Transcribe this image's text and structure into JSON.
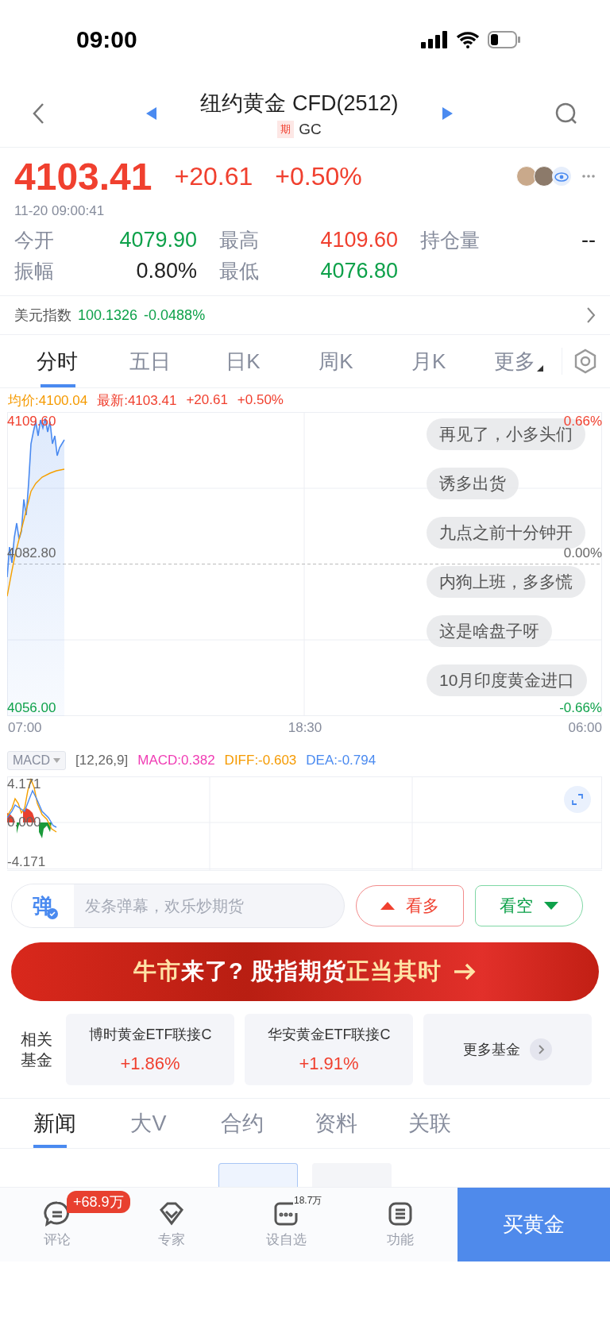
{
  "status_bar": {
    "time": "09:00"
  },
  "header": {
    "title": "纽约黄金 CFD(2512)",
    "tag": "期",
    "code": "GC"
  },
  "quote": {
    "price": "4103.41",
    "change": "+20.61",
    "change_pct": "+0.50%",
    "timestamp": "11-20 09:00:41"
  },
  "stats": [
    {
      "label": "今开",
      "value": "4079.90",
      "color": "#0ea14a"
    },
    {
      "label": "最高",
      "value": "4109.60",
      "color": "#f0402f"
    },
    {
      "label": "持仓量",
      "value": "--",
      "color": "#222222"
    },
    {
      "label": "振幅",
      "value": "0.80%",
      "color": "#222222"
    },
    {
      "label": "最低",
      "value": "4076.80",
      "color": "#0ea14a"
    }
  ],
  "index_bar": {
    "label": "美元指数",
    "value": "100.1326",
    "change": "-0.0488%"
  },
  "chart_tabs": [
    {
      "label": "分时",
      "selected": true,
      "kind": "tab"
    },
    {
      "label": "五日",
      "selected": false,
      "kind": "tab"
    },
    {
      "label": "日K",
      "selected": false,
      "kind": "tab"
    },
    {
      "label": "周K",
      "selected": false,
      "kind": "tab"
    },
    {
      "label": "月K",
      "selected": false,
      "kind": "tab"
    },
    {
      "label": "更多",
      "selected": false,
      "kind": "menu"
    }
  ],
  "intraday": {
    "avg": "均价:4100.04",
    "latest": "最新:4103.41",
    "change": "+20.61",
    "change_pct": "+0.50%",
    "y_high": "4109.60",
    "y_mid": "4082.80",
    "y_low": "4056.00",
    "pct_high": "0.66%",
    "pct_mid": "0.00%",
    "pct_low": "-0.66%",
    "x_labels": [
      "07:00",
      "18:30",
      "06:00"
    ]
  },
  "danmaku": [
    "再见了，小多头们",
    "诱多出货",
    "九点之前十分钟开",
    "内狗上班，多多慌",
    "这是啥盘子呀",
    "10月印度黄金进口"
  ],
  "macd": {
    "selector": "MACD",
    "params": "[12,26,9]",
    "macd": "MACD:0.382",
    "diff": "DIFF:-0.603",
    "dea": "DEA:-0.794",
    "y_high": "4.171",
    "y_mid": "0.000",
    "y_low": "-4.171"
  },
  "comment_bar": {
    "badge": "弹",
    "placeholder": "发条弹幕，欢乐炒期货",
    "bull": "看多",
    "bear": "看空"
  },
  "banner": {
    "text": "**牛市**来了? 股指期货**正当其时**"
  },
  "funds": {
    "label": "相关基金",
    "items": [
      {
        "name": "博时黄金ETF联接C",
        "change": "+1.86%"
      },
      {
        "name": "华安黄金ETF联接C",
        "change": "+1.91%"
      }
    ],
    "more": "更多基金"
  },
  "news_tabs": [
    {
      "label": "新闻",
      "selected": true
    },
    {
      "label": "大V",
      "selected": false
    },
    {
      "label": "合约",
      "selected": false
    },
    {
      "label": "资料",
      "selected": false
    },
    {
      "label": "关联",
      "selected": false
    }
  ],
  "sub_tabs": [
    {
      "selected": true
    },
    {
      "selected": false
    }
  ],
  "bottom_nav": {
    "items": [
      {
        "kind": "comment",
        "label": "评论",
        "badge": "+68.9万"
      },
      {
        "kind": "expert",
        "label": "专家"
      },
      {
        "kind": "watch",
        "label": "设自选",
        "count": "18.7万"
      },
      {
        "kind": "menu",
        "label": "功能"
      }
    ],
    "buy": "买黄金"
  }
}
